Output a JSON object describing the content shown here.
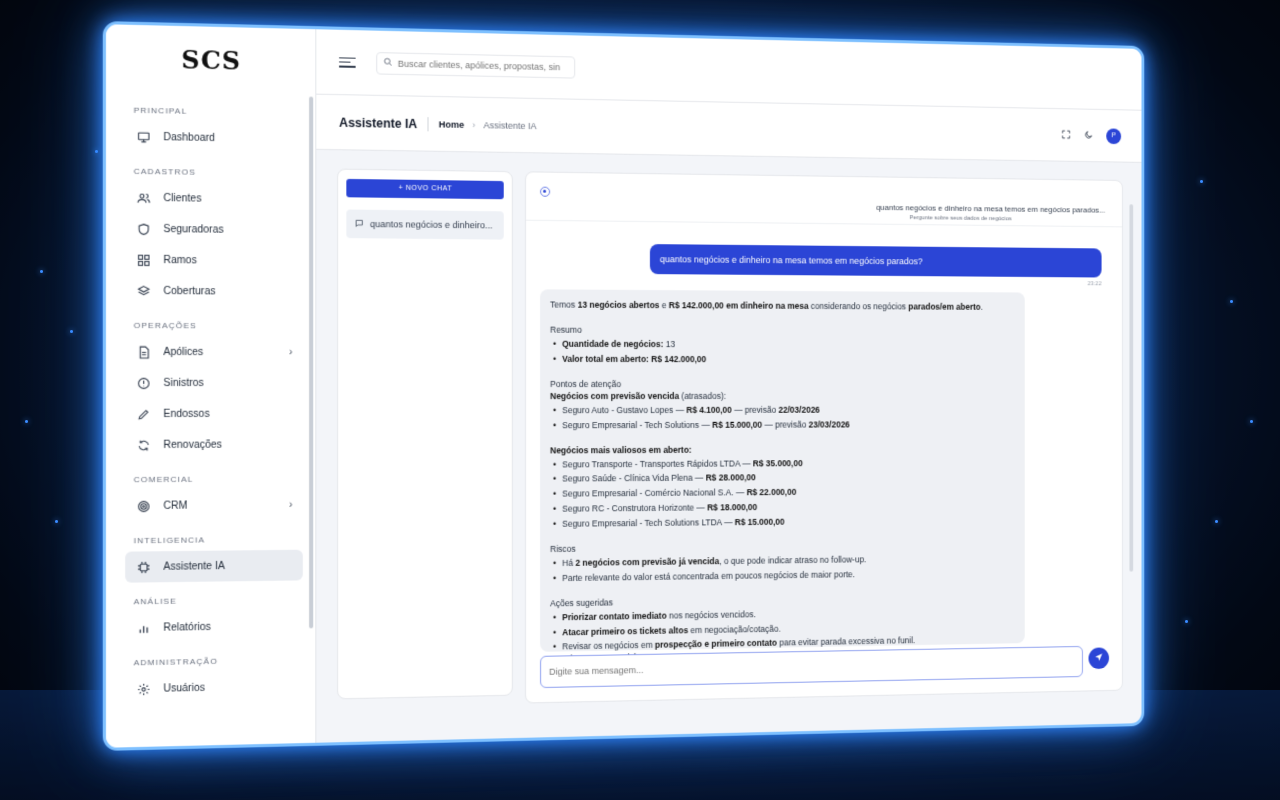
{
  "app": {
    "logo": "SCS"
  },
  "sidebar": {
    "sections": [
      {
        "label": "PRINCIPAL",
        "items": [
          {
            "label": "Dashboard",
            "icon": "monitor-icon"
          }
        ]
      },
      {
        "label": "CADASTROS",
        "items": [
          {
            "label": "Clientes",
            "icon": "users-icon"
          },
          {
            "label": "Seguradoras",
            "icon": "shield-icon"
          },
          {
            "label": "Ramos",
            "icon": "grid-icon"
          },
          {
            "label": "Coberturas",
            "icon": "layers-icon"
          }
        ]
      },
      {
        "label": "OPERAÇÕES",
        "items": [
          {
            "label": "Apólices",
            "icon": "document-icon"
          },
          {
            "label": "Sinistros",
            "icon": "alert-icon"
          },
          {
            "label": "Endossos",
            "icon": "pen-icon"
          },
          {
            "label": "Renovações",
            "icon": "refresh-icon"
          }
        ]
      },
      {
        "label": "COMERCIAL",
        "items": [
          {
            "label": "CRM",
            "icon": "target-icon"
          }
        ]
      },
      {
        "label": "INTELIGENCIA",
        "items": [
          {
            "label": "Assistente IA",
            "icon": "chip-icon"
          }
        ]
      },
      {
        "label": "ANÁLISE",
        "items": [
          {
            "label": "Relatórios",
            "icon": "bar-chart-icon"
          }
        ]
      },
      {
        "label": "ADMINISTRAÇÃO",
        "items": [
          {
            "label": "Usuários",
            "icon": "gear-icon"
          }
        ]
      }
    ]
  },
  "topbar": {
    "search_placeholder": "Buscar clientes, apólices, propostas, sinist"
  },
  "header": {
    "title": "Assistente IA",
    "crumb_home": "Home",
    "crumb_current": "Assistente IA",
    "avatar_initial": "P"
  },
  "chat_list": {
    "new_chat_label": "+ NOVO CHAT",
    "entries": [
      "quantos negócios e dinheiro..."
    ]
  },
  "chat": {
    "title": "quantos negócios e dinheiro na mesa temos em negócios parados...",
    "subtitle": "Pergunte sobre seus dados de negócios",
    "user_message": "quantos negócios e dinheiro na mesa temos em negócios parados?",
    "user_time": "23:22",
    "answer": {
      "intro_pre": "Temos ",
      "intro_b1": "13 negócios abertos",
      "intro_mid": " e ",
      "intro_b2": "R$ 142.000,00 em dinheiro na mesa",
      "intro_mid2": " considerando os negócios ",
      "intro_b3": "parados/em aberto",
      "intro_end": ".",
      "resumo_title": "Resumo",
      "resumo_1_label": "Quantidade de negócios:",
      "resumo_1_value": " 13",
      "resumo_2_label": "Valor total em aberto:",
      "resumo_2_value": " R$ 142.000,00",
      "atencao_title": "Pontos de atenção",
      "vencida_title_b": "Negócios com previsão vencida",
      "vencida_title_rest": " (atrasados):",
      "vencida_1_pre": "Seguro Auto - Gustavo Lopes — ",
      "vencida_1_b": "R$ 4.100,00",
      "vencida_1_post": " — previsão ",
      "vencida_1_date": "22/03/2026",
      "vencida_2_pre": "Seguro Empresarial - Tech Solutions — ",
      "vencida_2_b": "R$ 15.000,00",
      "vencida_2_post": " — previsão ",
      "vencida_2_date": "23/03/2026",
      "valiosos_title": "Negócios mais valiosos em aberto:",
      "valiosos": [
        {
          "pre": "Seguro Transporte - Transportes Rápidos LTDA — ",
          "b": "R$ 35.000,00"
        },
        {
          "pre": "Seguro Saúde - Clínica Vida Plena — ",
          "b": "R$ 28.000,00"
        },
        {
          "pre": "Seguro Empresarial - Comércio Nacional S.A. — ",
          "b": "R$ 22.000,00"
        },
        {
          "pre": "Seguro RC - Construtora Horizonte — ",
          "b": "R$ 18.000,00"
        },
        {
          "pre": "Seguro Empresarial - Tech Solutions LTDA — ",
          "b": "R$ 15.000,00"
        }
      ],
      "riscos_title": "Riscos",
      "riscos_1_pre": "Há ",
      "riscos_1_b": "2 negócios com previsão já vencida",
      "riscos_1_post": ", o que pode indicar atraso no follow-up.",
      "riscos_2": "Parte relevante do valor está concentrada em poucos negócios de maior porte.",
      "acoes_title": "Ações sugeridas",
      "acoes_1_b": "Priorizar contato imediato",
      "acoes_1_post": " nos negócios vencidos.",
      "acoes_2_b": "Atacar primeiro os tickets altos",
      "acoes_2_post": " em negociação/cotação.",
      "acoes_3_pre": "Revisar os negócios em ",
      "acoes_3_b": "prospecção e primeiro contato",
      "acoes_3_post": " para evitar parada excessiva no funil.",
      "closing": "Se quiser, posso também te mostrar:"
    },
    "composer_placeholder": "Digite sua mensagem..."
  },
  "colors": {
    "accent": "#2b45d6",
    "glow": "#2f86ff"
  }
}
